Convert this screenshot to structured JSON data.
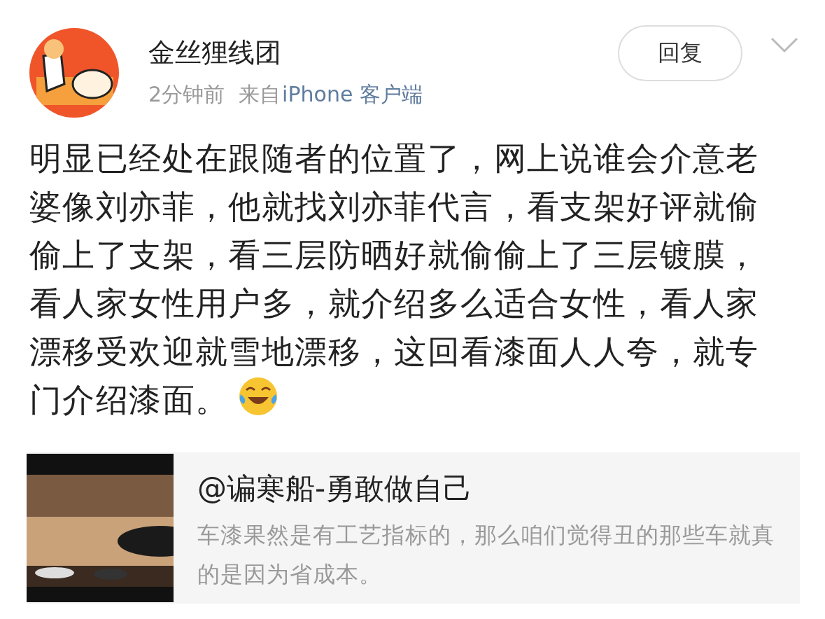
{
  "post": {
    "author": "金丝狸线团",
    "time": "2分钟前",
    "source_prefix": "来自",
    "source": "iPhone 客户端",
    "reply_button": "回复",
    "body": "明显已经处在跟随者的位置了，网上说谁会介意老婆像刘亦菲，他就找刘亦菲代言，看支架好评就偷偷上了支架，看三层防晒好就偷偷上了三层镀膜，看人家女性用户多，就介绍多么适合女性，看人家漂移受欢迎就雪地漂移，这回看漆面人人夸，就专门介绍漆面。"
  },
  "quoted": {
    "author": "@谝寒船-勇敢做自己",
    "text": "车漆果然是有工艺指标的，那么咱们觉得丑的那些车就真的是因为省成本。"
  }
}
